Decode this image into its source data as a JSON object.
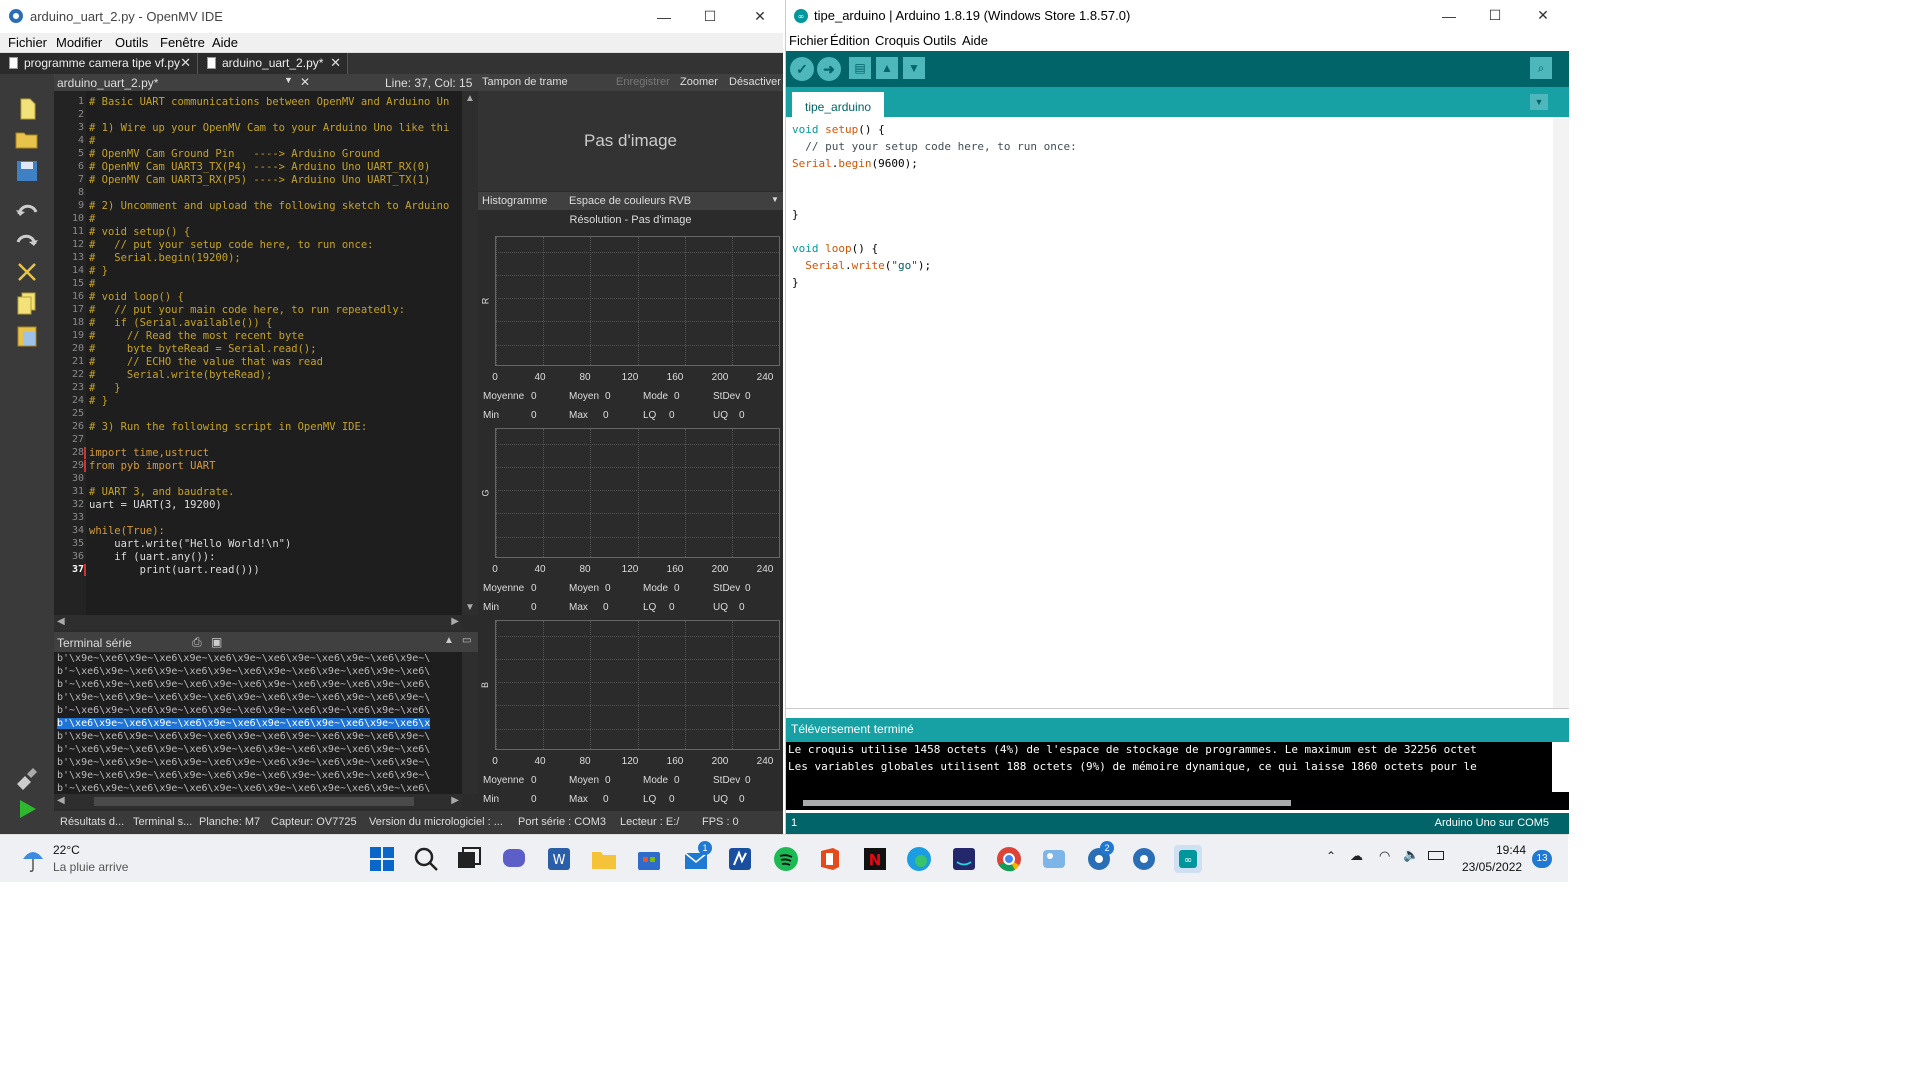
{
  "openmv": {
    "title": "arduino_uart_2.py - OpenMV IDE",
    "menu": [
      "Fichier",
      "Modifier",
      "Outils",
      "Fenêtre",
      "Aide"
    ],
    "tabs": [
      "programme camera tipe vf.py",
      "arduino_uart_2.py*"
    ],
    "editor_file": "arduino_uart_2.py*",
    "cursor": "Line: 37, Col: 15",
    "code": [
      "# Basic UART communications between OpenMV and Arduino Un",
      "",
      "# 1) Wire up your OpenMV Cam to your Arduino Uno like thi",
      "#",
      "# OpenMV Cam Ground Pin   ----> Arduino Ground",
      "# OpenMV Cam UART3_TX(P4) ----> Arduino Uno UART_RX(0)",
      "# OpenMV Cam UART3_RX(P5) ----> Arduino Uno UART_TX(1)",
      "",
      "# 2) Uncomment and upload the following sketch to Arduino",
      "#",
      "# void setup() {",
      "#   // put your setup code here, to run once:",
      "#   Serial.begin(19200);",
      "# }",
      "#",
      "# void loop() {",
      "#   // put your main code here, to run repeatedly:",
      "#   if (Serial.available()) {",
      "#     // Read the most recent byte",
      "#     byte byteRead = Serial.read();",
      "#     // ECHO the value that was read",
      "#     Serial.write(byteRead);",
      "#   }",
      "# }",
      "",
      "# 3) Run the following script in OpenMV IDE:",
      "",
      "import time,ustruct",
      "from pyb import UART",
      "",
      "# UART 3, and baudrate.",
      "uart = UART(3, 19200)",
      "",
      "while(True):",
      "    uart.write(\"Hello World!\\n\")",
      "    if (uart.any()):",
      "        print(uart.read()))"
    ],
    "line_numbers": [
      "1",
      "2",
      "3",
      "4",
      "5",
      "6",
      "7",
      "8",
      "9",
      "10",
      "11",
      "12",
      "13",
      "14",
      "15",
      "16",
      "17",
      "18",
      "19",
      "20",
      "21",
      "22",
      "23",
      "24",
      "25",
      "26",
      "27",
      "28",
      "29",
      "30",
      "31",
      "32",
      "33",
      "34",
      "35",
      "36",
      "37"
    ],
    "terminal_title": "Terminal série",
    "terminal_lines": [
      "b'\\x9e~\\xe6\\x9e~\\xe6\\x9e~\\xe6\\x9e~\\xe6\\x9e~\\xe6\\x9e~\\xe6\\x9e~\\",
      "b'~\\xe6\\x9e~\\xe6\\x9e~\\xe6\\x9e~\\xe6\\x9e~\\xe6\\x9e~\\xe6\\x9e~\\xe6\\",
      "b'~\\xe6\\x9e~\\xe6\\x9e~\\xe6\\x9e~\\xe6\\x9e~\\xe6\\x9e~\\xe6\\x9e~\\xe6\\",
      "b'\\x9e~\\xe6\\x9e~\\xe6\\x9e~\\xe6\\x9e~\\xe6\\x9e~\\xe6\\x9e~\\xe6\\x9e~\\",
      "b'~\\xe6\\x9e~\\xe6\\x9e~\\xe6\\x9e~\\xe6\\x9e~\\xe6\\x9e~\\xe6\\x9e~\\xe6\\",
      "b'\\xe6\\x9e~\\xe6\\x9e~\\xe6\\x9e~\\xe6\\x9e~\\xe6\\x9e~\\xe6\\x9e~\\xe6\\x",
      "b'\\x9e~\\xe6\\x9e~\\xe6\\x9e~\\xe6\\x9e~\\xe6\\x9e~\\xe6\\x9e~\\xe6\\x9e~\\",
      "b'~\\xe6\\x9e~\\xe6\\x9e~\\xe6\\x9e~\\xe6\\x9e~\\xe6\\x9e~\\xe6\\x9e~\\xe6\\",
      "b'\\x9e~\\xe6\\x9e~\\xe6\\x9e~\\xe6\\x9e~\\xe6\\x9e~\\xe6\\x9e~\\xe6\\x9e~\\",
      "b'\\x9e~\\xe6\\x9e~\\xe6\\x9e~\\xe6\\x9e~\\xe6\\x9e~\\xe6\\x9e~\\xe6\\x9e~\\",
      "b'~\\xe6\\x9e~\\xe6\\x9e~\\xe6\\x9e~\\xe6\\x9e~\\xe6\\x9e~\\xe6\\x9e~\\xe6\\"
    ],
    "frame_buffer": {
      "title": "Tampon de trame",
      "record": "Enregistrer",
      "zoom": "Zoomer",
      "disable": "Désactiver",
      "empty": "Pas d'image"
    },
    "histogram": {
      "title": "Histogramme",
      "colorspace": "Espace de couleurs RVB",
      "resolution": "Résolution - Pas d'image",
      "ticks": [
        "0",
        "40",
        "80",
        "120",
        "160",
        "200",
        "240"
      ],
      "channels": [
        {
          "name": "R",
          "mean": "0",
          "median": "0",
          "mode": "0",
          "stdev": "0",
          "min": "0",
          "max": "0",
          "lq": "0",
          "uq": "0"
        },
        {
          "name": "G",
          "mean": "0",
          "median": "0",
          "mode": "0",
          "stdev": "0",
          "min": "0",
          "max": "0",
          "lq": "0",
          "uq": "0"
        },
        {
          "name": "B",
          "mean": "0",
          "median": "0",
          "mode": "0",
          "stdev": "0",
          "min": "0",
          "max": "0",
          "lq": "0",
          "uq": "0"
        }
      ],
      "labels": {
        "mean": "Moyenne",
        "median": "Moyen",
        "mode": "Mode",
        "stdev": "StDev",
        "min": "Min",
        "max": "Max",
        "lq": "LQ",
        "uq": "UQ"
      }
    },
    "status": [
      "Résultats d...",
      "Terminal s...",
      "Planche: M7",
      "Capteur: OV7725",
      "Version du micrologiciel : ...",
      "Port série : COM3",
      "Lecteur : E:/",
      "FPS : 0"
    ]
  },
  "arduino": {
    "title": "tipe_arduino | Arduino 1.8.19 (Windows Store 1.8.57.0)",
    "menu": [
      "Fichier",
      "Édition",
      "Croquis",
      "Outils",
      "Aide"
    ],
    "tab": "tipe_arduino",
    "message": "Téléversement terminé",
    "console": [
      "Le croquis utilise 1458 octets (4%) de l'espace de stockage de programmes. Le maximum est de 32256 octet",
      "Les variables globales utilisent 188 octets (9%) de mémoire dynamique, ce qui laisse 1860 octets pour le"
    ],
    "status_line": "1",
    "board": "Arduino Uno sur COM5"
  },
  "taskbar": {
    "weather_temp": "22°C",
    "weather_text": "La pluie arrive",
    "time": "19:44",
    "date": "23/05/2022",
    "notif_count": "13",
    "mail_badge": "1",
    "openmv_badge": "2"
  }
}
